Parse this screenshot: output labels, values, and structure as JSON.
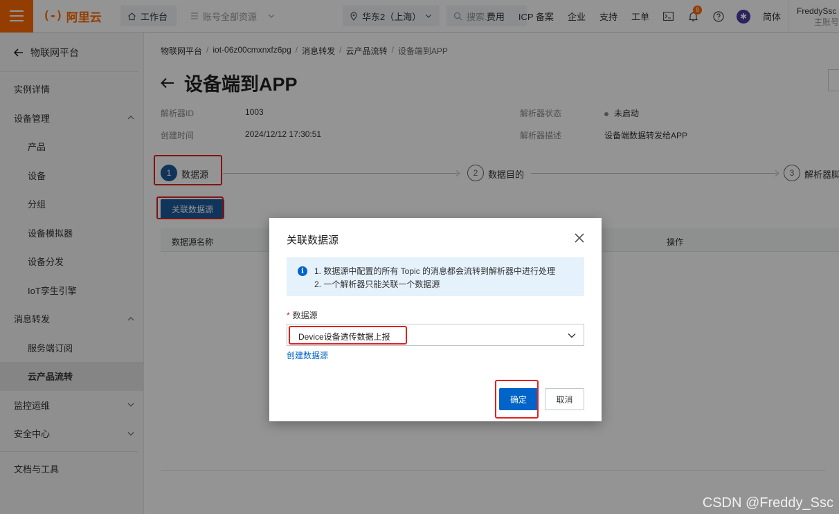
{
  "topbar": {
    "logo_mark": "(-)",
    "logo_text": "阿里云",
    "workspace": "工作台",
    "resource_group": "账号全部资源",
    "region": "华东2（上海）",
    "search_placeholder": "搜索...",
    "links": [
      "费用",
      "ICP 备案",
      "企业",
      "支持",
      "工单"
    ],
    "notification_count": "8",
    "language": "简体",
    "user_name": "FreddySsc",
    "user_role": "主账号"
  },
  "sidebar": {
    "back_label": "物联网平台",
    "items": [
      {
        "label": "实例详情"
      },
      {
        "label": "设备管理"
      },
      {
        "label": "产品"
      },
      {
        "label": "设备"
      },
      {
        "label": "分组"
      },
      {
        "label": "设备模拟器"
      },
      {
        "label": "设备分发"
      },
      {
        "label": "IoT孪生引擎"
      },
      {
        "label": "消息转发"
      },
      {
        "label": "服务端订阅"
      },
      {
        "label": "云产品流转"
      },
      {
        "label": "监控运维"
      },
      {
        "label": "安全中心"
      },
      {
        "label": "文档与工具"
      }
    ]
  },
  "breadcrumb": [
    "物联网平台",
    "iot-06z00cmxnxfz6pg",
    "消息转发",
    "云产品流转",
    "设备端到APP"
  ],
  "page": {
    "title": "设备端到APP",
    "parser_id_label": "解析器ID",
    "parser_id": "1003",
    "created_label": "创建时间",
    "created": "2024/12/12 17:30:51",
    "status_label": "解析器状态",
    "status": "未启动",
    "desc_label": "解析器描述",
    "desc": "设备端数据转发给APP"
  },
  "steps": [
    {
      "num": "1",
      "label": "数据源"
    },
    {
      "num": "2",
      "label": "数据目的"
    },
    {
      "num": "3",
      "label": "解析器脚"
    }
  ],
  "assoc_button": "关联数据源",
  "table": {
    "col_name": "数据源名称",
    "col_action": "操作"
  },
  "dialog": {
    "title": "关联数据源",
    "notice_lines": [
      "1. 数据源中配置的所有 Topic 的消息都会流转到解析器中进行处理",
      "2. 一个解析器只能关联一个数据源"
    ],
    "required_mark": "*",
    "field_label": "数据源",
    "select_value": "Device设备透传数据上报",
    "create_link": "创建数据源",
    "ok": "确定",
    "cancel": "取消"
  },
  "watermark": "CSDN @Freddy_Ssc",
  "colors": {
    "brand_orange": "#ff6a00",
    "primary_blue": "#0064c8",
    "annotation_red": "#e02020"
  }
}
